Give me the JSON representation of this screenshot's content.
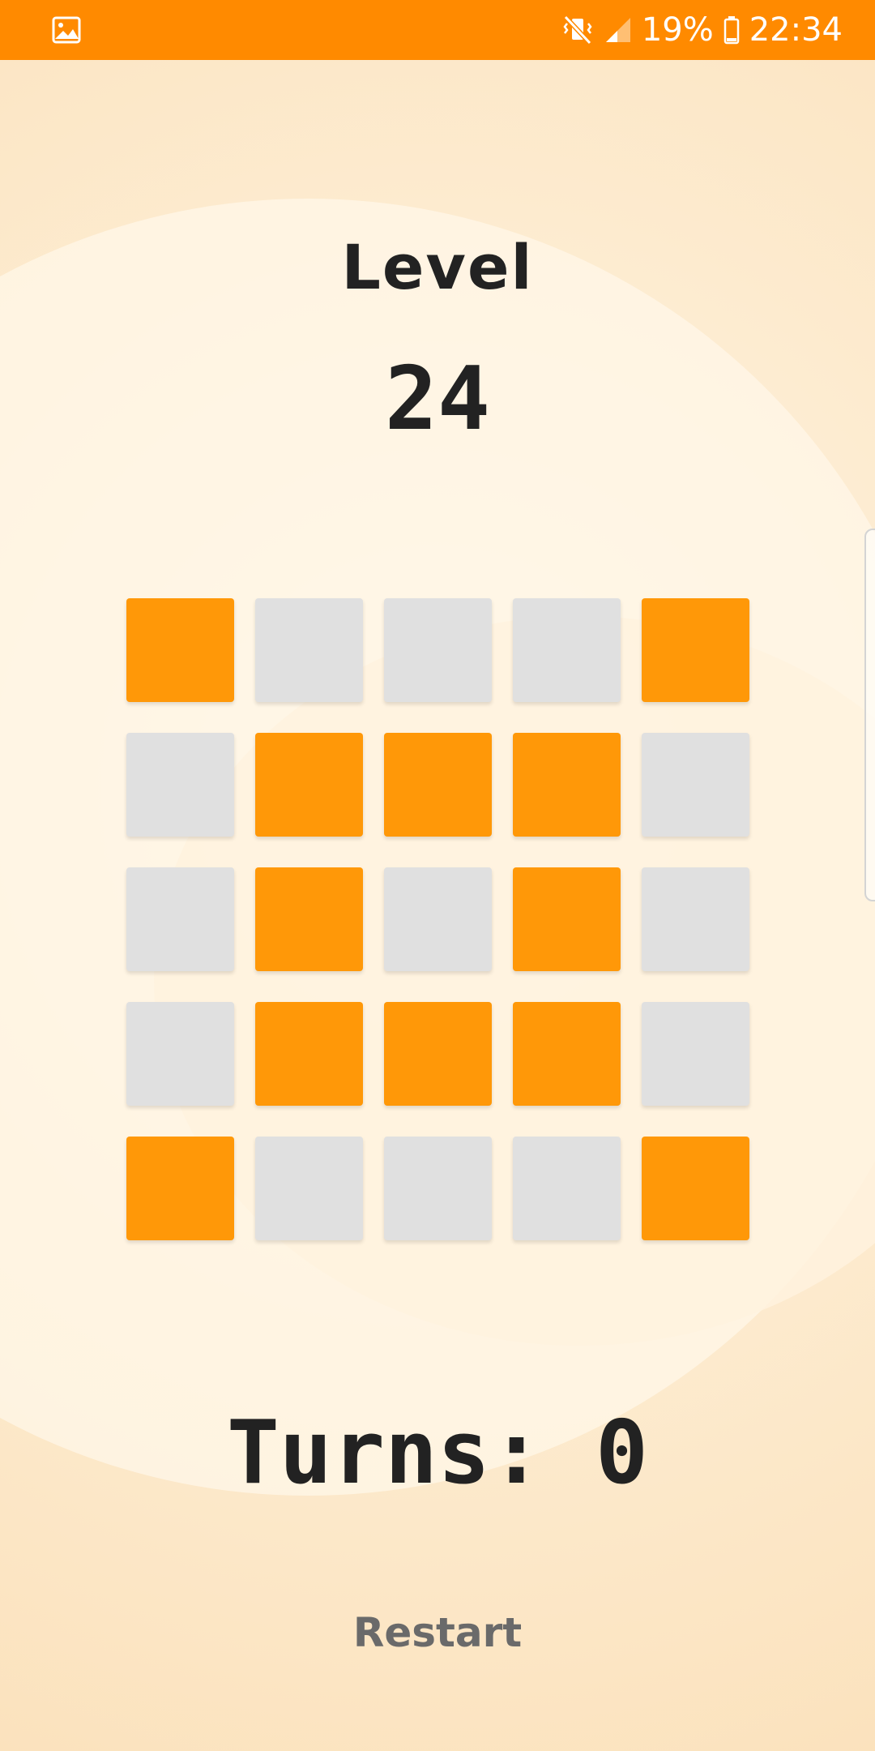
{
  "status_bar": {
    "battery": "19%",
    "time": "22:34",
    "icons": [
      "gallery-icon",
      "vibrate-mute-icon",
      "signal-icon",
      "battery-icon"
    ]
  },
  "game": {
    "level_label": "Level",
    "level_number": "24",
    "turns_text": "Turns: 0",
    "restart_label": "Restart",
    "grid": [
      [
        1,
        0,
        0,
        0,
        1
      ],
      [
        0,
        1,
        1,
        1,
        0
      ],
      [
        0,
        1,
        0,
        1,
        0
      ],
      [
        0,
        1,
        1,
        1,
        0
      ],
      [
        1,
        0,
        0,
        0,
        1
      ]
    ]
  },
  "colors": {
    "status_bar": "#ff8a00",
    "tile_on": "#ff9808",
    "tile_off": "#e0e0e0",
    "text": "#222222",
    "restart_text": "#6a6a6a"
  }
}
